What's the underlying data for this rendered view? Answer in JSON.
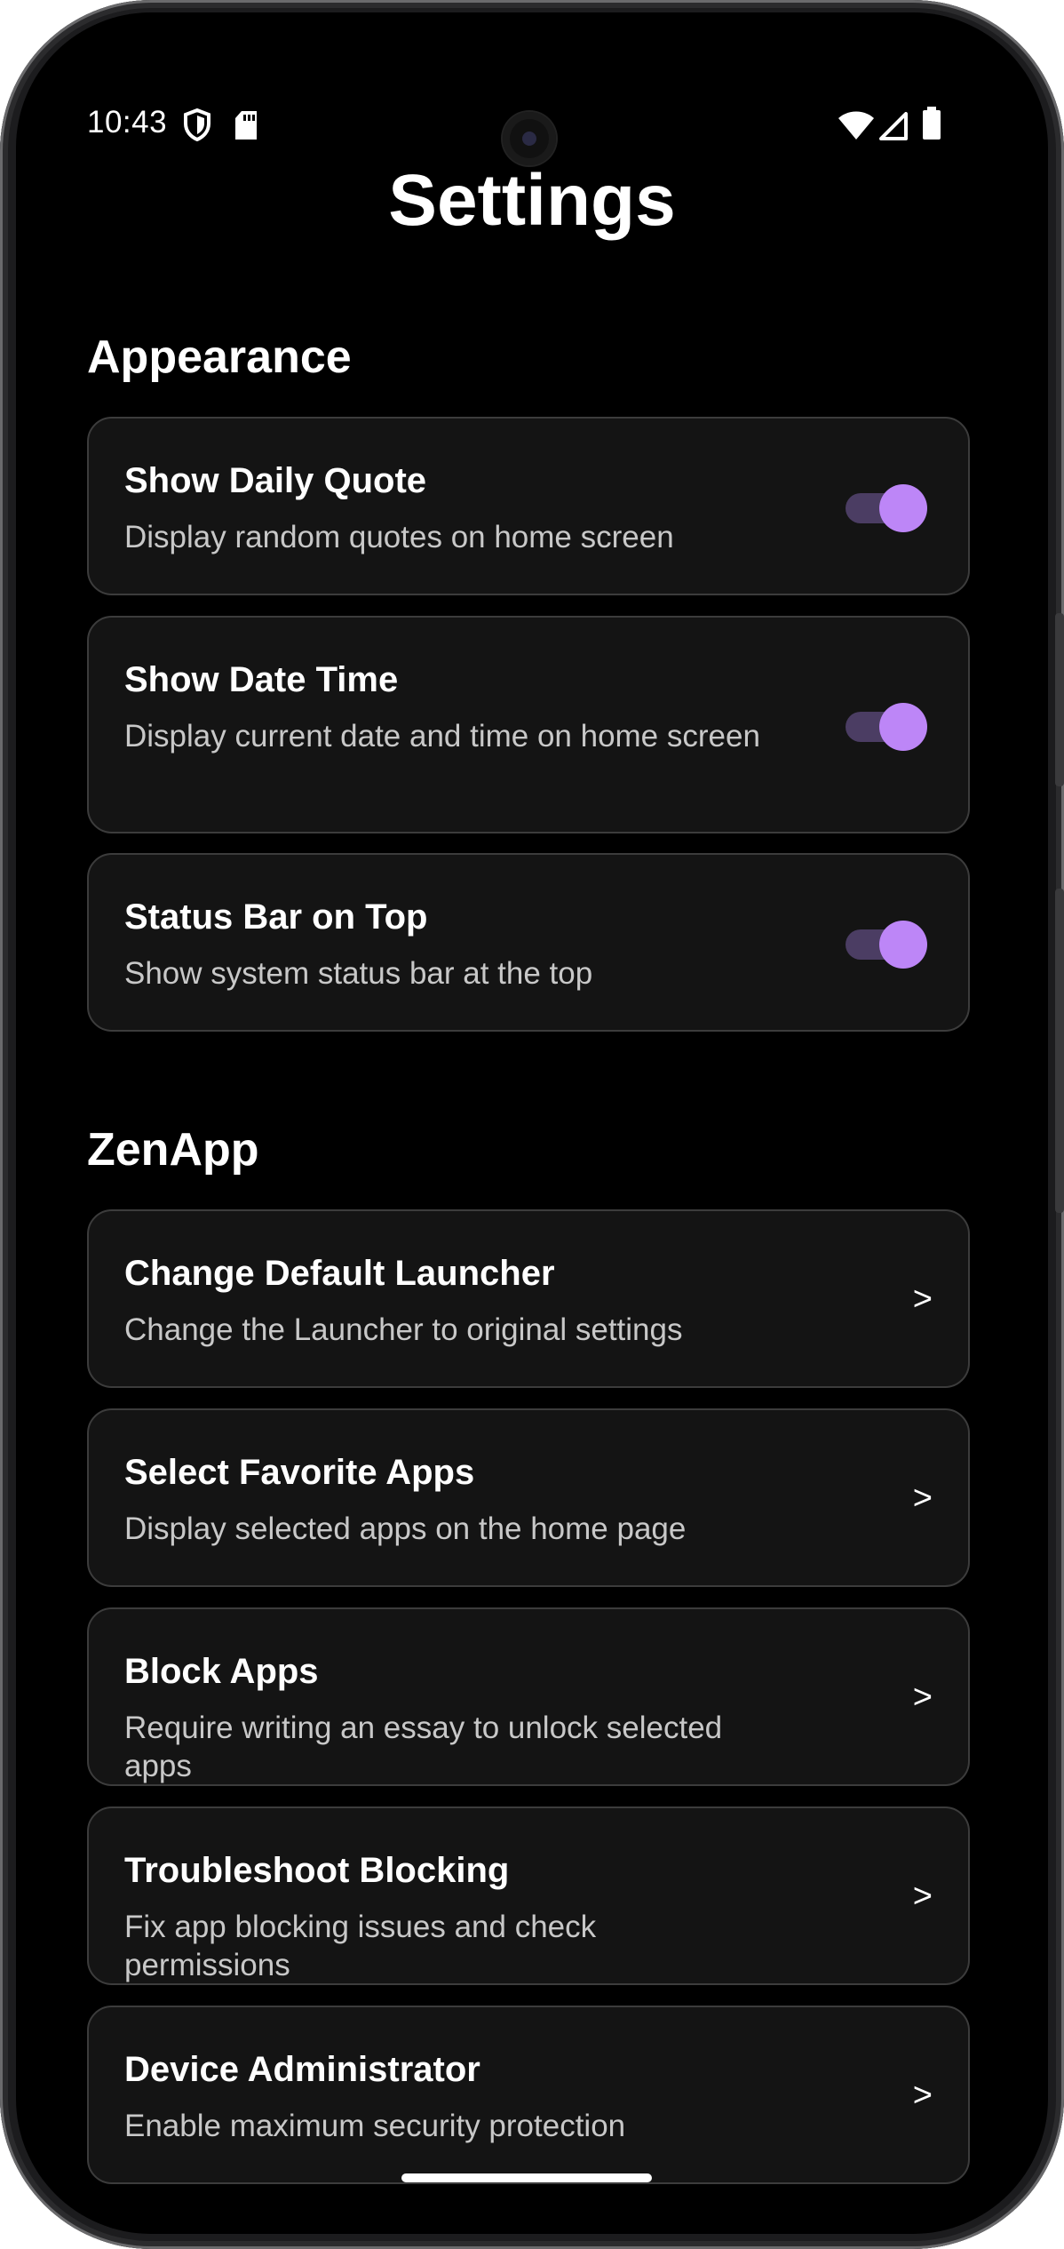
{
  "status_bar": {
    "time": "10:43",
    "left_icons": [
      "shield-icon",
      "sd-card-icon"
    ],
    "right_icons": [
      "wifi-icon",
      "cell-signal-icon",
      "battery-icon"
    ]
  },
  "page": {
    "title": "Settings"
  },
  "sections": [
    {
      "title": "Appearance",
      "items": [
        {
          "title": "Show Daily Quote",
          "subtitle": "Display random quotes on home screen",
          "control": "toggle",
          "enabled": true
        },
        {
          "title": "Show Date Time",
          "subtitle": "Display current date and time on home screen",
          "control": "toggle",
          "enabled": true
        },
        {
          "title": "Status Bar on Top",
          "subtitle": "Show system status bar at the top",
          "control": "toggle",
          "enabled": true
        }
      ]
    },
    {
      "title": "ZenApp",
      "items": [
        {
          "title": "Change Default Launcher",
          "subtitle": "Change the Launcher to original settings",
          "control": "chevron",
          "chevron": ">"
        },
        {
          "title": "Select Favorite Apps",
          "subtitle": "Display selected apps on the home page",
          "control": "chevron",
          "chevron": ">"
        },
        {
          "title": "Block Apps",
          "subtitle": "Require writing an essay to unlock selected apps",
          "control": "chevron",
          "chevron": ">"
        },
        {
          "title": "Troubleshoot Blocking",
          "subtitle": "Fix app blocking issues and check permissions",
          "control": "chevron",
          "chevron": ">"
        },
        {
          "title": "Device Administrator",
          "subtitle": "Enable maximum security protection",
          "control": "chevron",
          "chevron": ">"
        }
      ]
    }
  ],
  "colors": {
    "accent": "#bd86f7",
    "toggle_track": "#4b3d63",
    "card_background": "#141414",
    "card_border": "#3c3c3c",
    "screen_background": "#000000"
  }
}
